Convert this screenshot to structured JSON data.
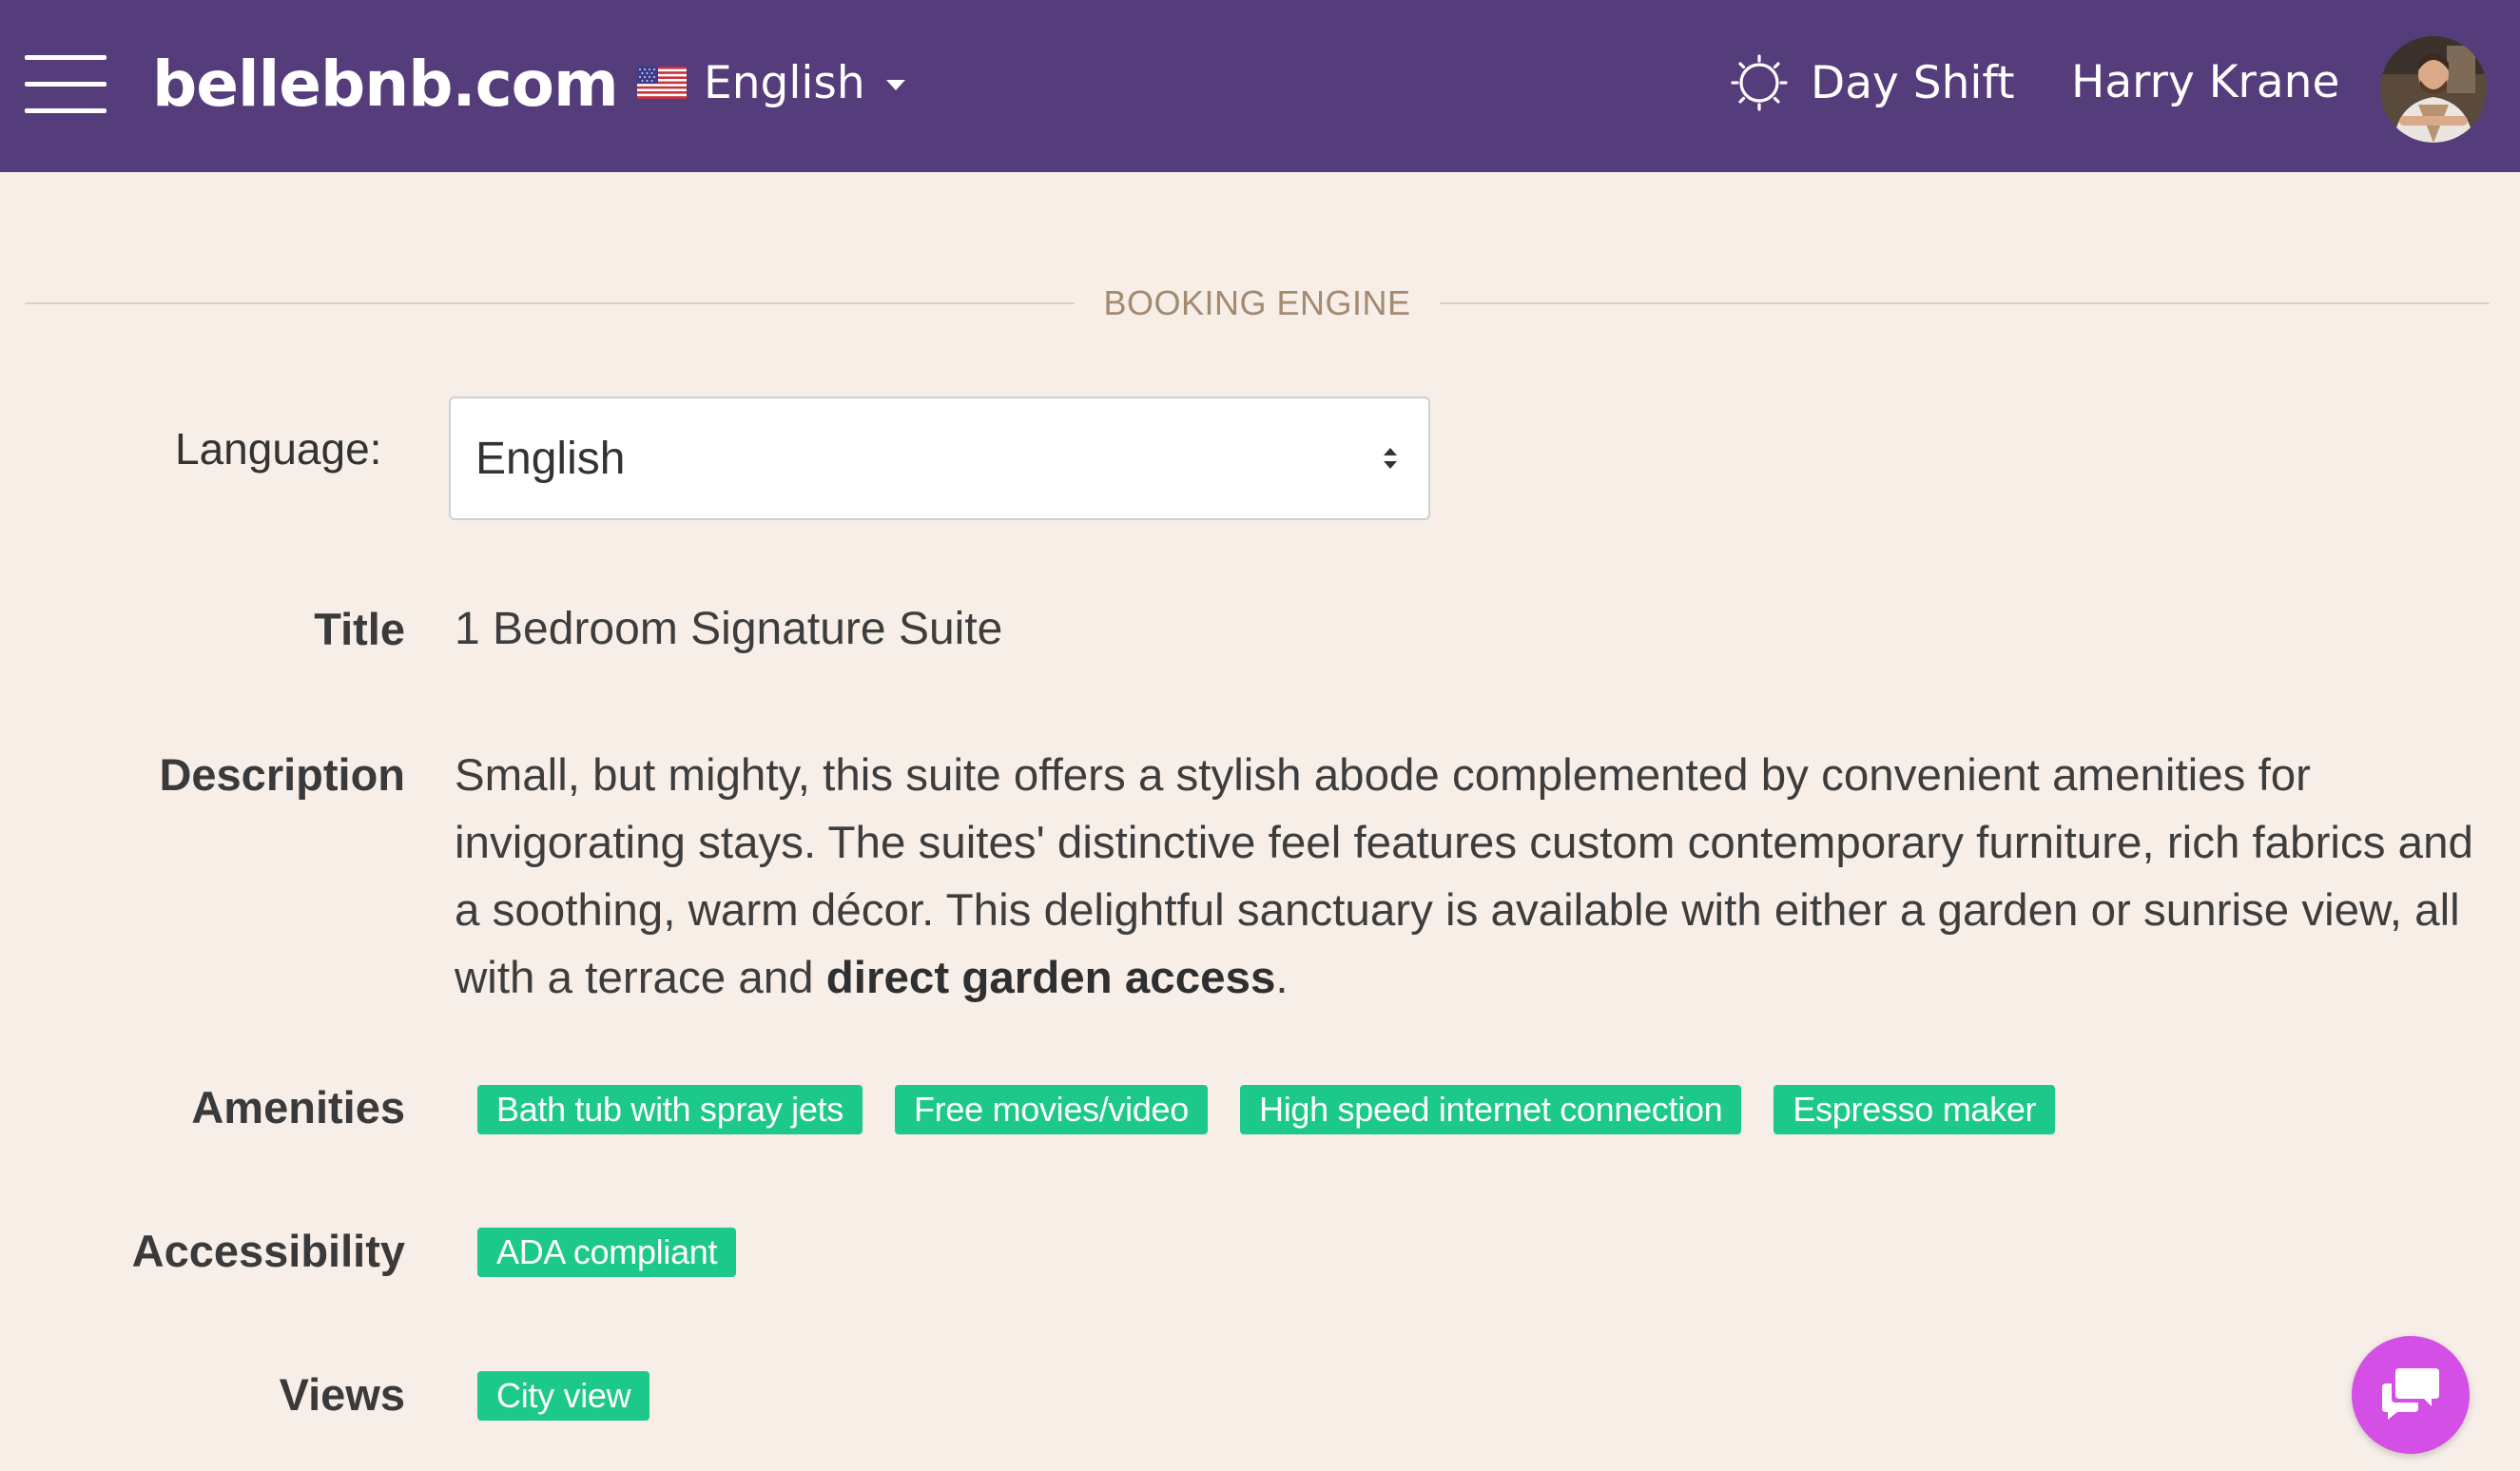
{
  "header": {
    "logo": "bellebnb.com",
    "language_switch": "English",
    "shift_label": "Day Shift",
    "user_name": "Harry Krane"
  },
  "section": {
    "title": "BOOKING ENGINE"
  },
  "form": {
    "language_label": "Language:",
    "language_value": "English"
  },
  "room": {
    "title_label": "Title",
    "title": "1 Bedroom Signature Suite",
    "description_label": "Description",
    "description_text": "Small, but mighty, this suite offers a stylish abode complemented by convenient amenities for invigorating stays. The suites' distinctive feel features custom contemporary furniture, rich fabrics and a soothing, warm décor. This delightful sanctuary is available with either a garden or sunrise view, all with a terrace and",
    "description_bold": "direct garden access",
    "description_end": ".",
    "amenities_label": "Amenities",
    "amenities": [
      "Bath tub with spray jets",
      "Free movies/video",
      "High speed internet connection",
      "Espresso maker"
    ],
    "accessibility_label": "Accessibility",
    "accessibility": [
      "ADA compliant"
    ],
    "views_label": "Views",
    "views": [
      "City view"
    ]
  },
  "colors": {
    "header_bg": "#553c7b",
    "page_bg": "#f6eee7",
    "tag_bg": "#1dc98a",
    "section_title": "#a38a70",
    "chat_button": "#d34fe6"
  },
  "icons": {
    "menu": "hamburger-menu-icon",
    "flag": "us-flag-icon",
    "shift": "sun-icon",
    "chat": "chat-bubbles-icon"
  }
}
